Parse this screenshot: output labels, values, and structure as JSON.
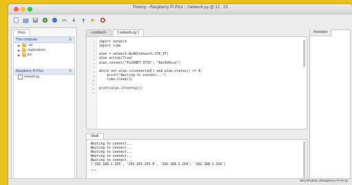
{
  "window": {
    "title": "Thonny - Raspberry Pi Pico :: /network.py @ 12 : 23"
  },
  "toolbar": {
    "buttons": [
      {
        "name": "new-file-icon",
        "color": "#5a6f9c"
      },
      {
        "name": "open-file-icon",
        "color": "#4a74b4"
      },
      {
        "name": "save-file-icon",
        "color": "#6b6b6b"
      },
      {
        "name": "run-icon",
        "color": "#2d8a2d"
      },
      {
        "name": "debug-icon",
        "color": "#3a77c0"
      },
      {
        "name": "step-over-icon",
        "color": "#2a8da8"
      },
      {
        "name": "step-into-icon",
        "color": "#2a8da8"
      },
      {
        "name": "step-out-icon",
        "color": "#2a8da8"
      },
      {
        "name": "resume-icon",
        "color": "#f2a516"
      },
      {
        "name": "stop-icon",
        "color": "#d33b2f"
      }
    ]
  },
  "files_panel": {
    "tab_label": "Files",
    "computer_section": "This computer",
    "computer_items": [
      ".vol",
      "Applications",
      "bin"
    ],
    "pico_section": "Raspberry Pi Pico",
    "pico_items": [
      "network.py"
    ]
  },
  "editor": {
    "tabs": [
      "<untitled>",
      "[ network.py ]"
    ],
    "line_numbers": [
      "1",
      "2",
      "3",
      "4",
      "5",
      "6",
      "7",
      "8",
      "9",
      "10",
      "11",
      "12",
      "13"
    ],
    "code": [
      "import network",
      "import time",
      "",
      "wlan = network.WLAN(network.STA_IF)",
      "wlan.active(True)",
      "wlan.connect(\"PLUSNET-3TCK\", \"6ec8d4cca\")",
      "",
      "while not wlan.isconnected() and wlan.status() >= 0:",
      "    print(\"Waiting to connect...\")",
      "    time.sleep(1)",
      "",
      "print(wlan.ifconfig())",
      ""
    ]
  },
  "assistant": {
    "tab_label": "Assistant"
  },
  "shell": {
    "tab_label": "Shell",
    "lines": [
      "Waiting to connect...",
      "Waiting to connect...",
      "Waiting to connect...",
      "Waiting to connect...",
      "Waiting to connect...",
      "('192.168.1.155', '255.255.255.0', '192.168.1.254', '192.168.1.254')"
    ],
    "prompt": ">>>"
  },
  "statusbar": {
    "interpreter": "MicroPython (Raspberry Pi Pico)"
  }
}
